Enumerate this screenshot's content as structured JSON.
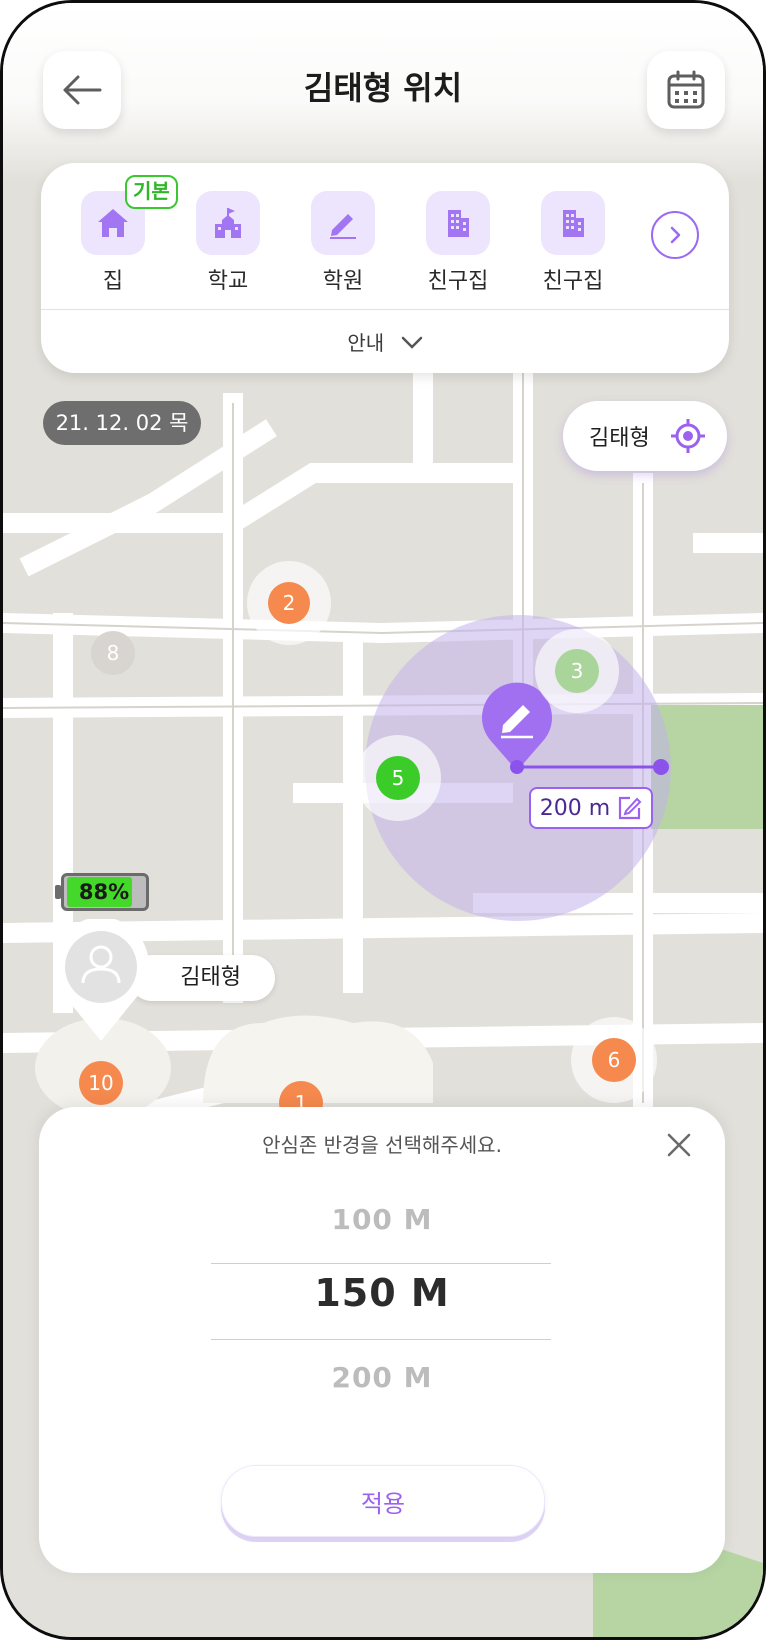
{
  "header": {
    "title": "김태형 위치",
    "back_icon": "back-arrow-icon",
    "calendar_icon": "calendar-icon"
  },
  "zones": {
    "items": [
      {
        "label": "집",
        "icon": "home-icon",
        "badge": "기본"
      },
      {
        "label": "학교",
        "icon": "school-icon"
      },
      {
        "label": "학원",
        "icon": "pencil-icon"
      },
      {
        "label": "친구집",
        "icon": "building-icon"
      },
      {
        "label": "친구집",
        "icon": "building-icon"
      }
    ],
    "guide": "안내"
  },
  "map": {
    "date": "21. 12. 02 목",
    "locate_name": "김태형",
    "clusters": {
      "c1": "1",
      "c2": "2",
      "c3": "3",
      "c5": "5",
      "c6": "6",
      "c8": "8",
      "c10": "10"
    },
    "radius_label": "200 m",
    "battery": {
      "value": 88,
      "text": "88%"
    },
    "user_name": "김태형"
  },
  "sheet": {
    "title": "안심존 반경을 선택해주세요.",
    "options": [
      "100  M",
      "150  M",
      "200  M"
    ],
    "selected": "150  M",
    "apply_label": "적용"
  },
  "colors": {
    "accent": "#9b62f0",
    "orange": "#f5894e",
    "green": "#3ccc2a",
    "light_green": "#a9d59a",
    "park": "#b6d5a3"
  }
}
